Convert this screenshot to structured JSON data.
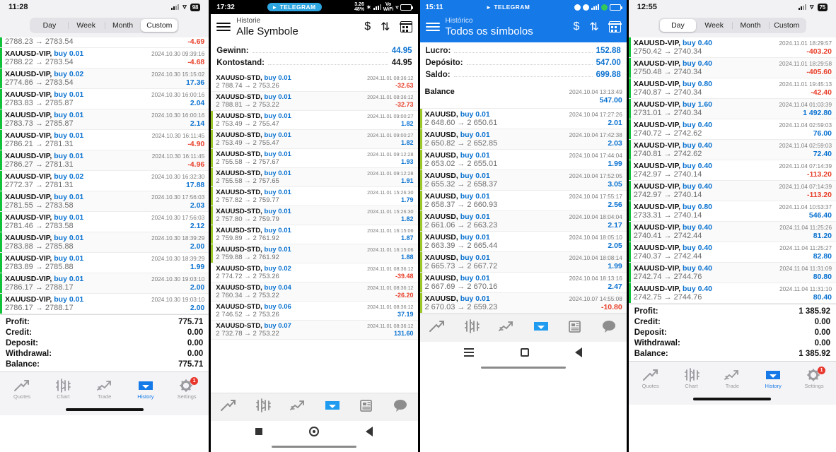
{
  "panel1": {
    "status": {
      "time": "11:28",
      "battery": "98",
      "wifi_icon": "wifi-icon",
      "signal_icon": "signal-icon"
    },
    "period_tabs": [
      {
        "label": "Day",
        "selected": false
      },
      {
        "label": "Week",
        "selected": false
      },
      {
        "label": "Month",
        "selected": false
      },
      {
        "label": "Custom",
        "selected": true
      }
    ],
    "partial_top_row": {
      "prices": "2788.23 → 2783.54",
      "pl": "-4.69"
    },
    "deals": [
      {
        "symbol": "XAUUSD-VIP,",
        "side": "buy 0.01",
        "time": "2024.10.30 09:39:16",
        "prices": "2788.22 → 2783.54",
        "pl": "-4.68",
        "neg": true
      },
      {
        "symbol": "XAUUSD-VIP,",
        "side": "buy 0.02",
        "time": "2024.10.30 15:15:02",
        "prices": "2774.86 → 2783.54",
        "pl": "17.36",
        "neg": false
      },
      {
        "symbol": "XAUUSD-VIP,",
        "side": "buy 0.01",
        "time": "2024.10.30 16:00:16",
        "prices": "2783.83 → 2785.87",
        "pl": "2.04",
        "neg": false
      },
      {
        "symbol": "XAUUSD-VIP,",
        "side": "buy 0.01",
        "time": "2024.10.30 16:00:16",
        "prices": "2783.73 → 2785.87",
        "pl": "2.14",
        "neg": false
      },
      {
        "symbol": "XAUUSD-VIP,",
        "side": "buy 0.01",
        "time": "2024.10.30 16:11:45",
        "prices": "2786.21 → 2781.31",
        "pl": "-4.90",
        "neg": true
      },
      {
        "symbol": "XAUUSD-VIP,",
        "side": "buy 0.01",
        "time": "2024.10.30 16:11:45",
        "prices": "2786.27 → 2781.31",
        "pl": "-4.96",
        "neg": true
      },
      {
        "symbol": "XAUUSD-VIP,",
        "side": "buy 0.02",
        "time": "2024.10.30 16:32:30",
        "prices": "2772.37 → 2781.31",
        "pl": "17.88",
        "neg": false
      },
      {
        "symbol": "XAUUSD-VIP,",
        "side": "buy 0.01",
        "time": "2024.10.30 17:56:03",
        "prices": "2781.55 → 2783.58",
        "pl": "2.03",
        "neg": false
      },
      {
        "symbol": "XAUUSD-VIP,",
        "side": "buy 0.01",
        "time": "2024.10.30 17:56:03",
        "prices": "2781.46 → 2783.58",
        "pl": "2.12",
        "neg": false
      },
      {
        "symbol": "XAUUSD-VIP,",
        "side": "buy 0.01",
        "time": "2024.10.30 18:39:29",
        "prices": "2783.88 → 2785.88",
        "pl": "2.00",
        "neg": false
      },
      {
        "symbol": "XAUUSD-VIP,",
        "side": "buy 0.01",
        "time": "2024.10.30 18:39:29",
        "prices": "2783.89 → 2785.88",
        "pl": "1.99",
        "neg": false
      },
      {
        "symbol": "XAUUSD-VIP,",
        "side": "buy 0.01",
        "time": "2024.10.30 19:03:10",
        "prices": "2786.17 → 2788.17",
        "pl": "2.00",
        "neg": false
      },
      {
        "symbol": "XAUUSD-VIP,",
        "side": "buy 0.01",
        "time": "2024.10.30 19:03:10",
        "prices": "2786.17 → 2788.17",
        "pl": "2.00",
        "neg": false
      }
    ],
    "totals": [
      {
        "label": "Profit:",
        "value": "775.71"
      },
      {
        "label": "Credit:",
        "value": "0.00"
      },
      {
        "label": "Deposit:",
        "value": "0.00"
      },
      {
        "label": "Withdrawal:",
        "value": "0.00"
      },
      {
        "label": "Balance:",
        "value": "775.71"
      }
    ],
    "tabs": [
      {
        "label": "Quotes",
        "icon": "quotes-icon",
        "selected": false,
        "badge": ""
      },
      {
        "label": "Chart",
        "icon": "chart-icon",
        "selected": false,
        "badge": ""
      },
      {
        "label": "Trade",
        "icon": "trade-icon",
        "selected": false,
        "badge": ""
      },
      {
        "label": "History",
        "icon": "history-icon",
        "selected": true,
        "badge": ""
      },
      {
        "label": "Settings",
        "icon": "settings-gear-icon",
        "selected": false,
        "badge": "1"
      }
    ]
  },
  "panel2": {
    "status": {
      "time": "17:32",
      "telegram": "TELEGRAM",
      "data_rate": "3.26",
      "data_unit": "48%",
      "volte": "Vo",
      "wifi_label": "WiFi"
    },
    "header": {
      "subtitle": "Historie",
      "title": "Alle Symbole",
      "icon_currency": "currency-filter-icon",
      "icon_sort": "sort-icon",
      "icon_calendar": "calendar-icon",
      "menu_icon": "hamburger-menu-icon"
    },
    "summary": [
      {
        "label": "Gewinn:",
        "value": "44.95",
        "accent": true
      },
      {
        "label": "Kontostand:",
        "value": "44.95",
        "accent": false
      }
    ],
    "deals": [
      {
        "symbol": "XAUUSD-STD,",
        "side": "buy 0.01",
        "time": "2024.11.01 08:36:12",
        "prices": "2 788.74 → 2 753.26",
        "pl": "-32.63",
        "neg": true,
        "bar": "none"
      },
      {
        "symbol": "XAUUSD-STD,",
        "side": "buy 0.01",
        "time": "2024.11.01 08:36:12",
        "prices": "2 788.81 → 2 753.22",
        "pl": "-32.73",
        "neg": true,
        "bar": "none"
      },
      {
        "symbol": "XAUUSD-STD,",
        "side": "buy 0.01",
        "time": "2024.11.01 09:00:27",
        "prices": "2 753.49 → 2 755.47",
        "pl": "1.82",
        "neg": false,
        "bar": "olive"
      },
      {
        "symbol": "XAUUSD-STD,",
        "side": "buy 0.01",
        "time": "2024.11.01 09:00:27",
        "prices": "2 753.49 → 2 755.47",
        "pl": "1.82",
        "neg": false,
        "bar": "olive"
      },
      {
        "symbol": "XAUUSD-STD,",
        "side": "buy 0.01",
        "time": "2024.11.01 09:12:28",
        "prices": "2 755.58 → 2 757.67",
        "pl": "1.93",
        "neg": false,
        "bar": "olive"
      },
      {
        "symbol": "XAUUSD-STD,",
        "side": "buy 0.01",
        "time": "2024.11.01 09:12:28",
        "prices": "2 755.58 → 2 757.65",
        "pl": "1.91",
        "neg": false,
        "bar": "olive"
      },
      {
        "symbol": "XAUUSD-STD,",
        "side": "buy 0.01",
        "time": "2024.11.01 15:26:30",
        "prices": "2 757.82 → 2 759.77",
        "pl": "1.79",
        "neg": false,
        "bar": "olive"
      },
      {
        "symbol": "XAUUSD-STD,",
        "side": "buy 0.01",
        "time": "2024.11.01 15:26:30",
        "prices": "2 757.80 → 2 759.79",
        "pl": "1.82",
        "neg": false,
        "bar": "olive"
      },
      {
        "symbol": "XAUUSD-STD,",
        "side": "buy 0.01",
        "time": "2024.11.01 16:15:06",
        "prices": "2 759.89 → 2 761.92",
        "pl": "1.87",
        "neg": false,
        "bar": "olive"
      },
      {
        "symbol": "XAUUSD-STD,",
        "side": "buy 0.01",
        "time": "2024.11.01 16:15:06",
        "prices": "2 759.88 → 2 761.92",
        "pl": "1.88",
        "neg": false,
        "bar": "olive"
      },
      {
        "symbol": "XAUUSD-STD,",
        "side": "buy 0.02",
        "time": "2024.11.01 08:36:12",
        "prices": "2 774.72 → 2 753.26",
        "pl": "-39.48",
        "neg": true,
        "bar": "none"
      },
      {
        "symbol": "XAUUSD-STD,",
        "side": "buy 0.04",
        "time": "2024.11.01 08:36:12",
        "prices": "2 760.34 → 2 753.22",
        "pl": "-26.20",
        "neg": true,
        "bar": "none"
      },
      {
        "symbol": "XAUUSD-STD,",
        "side": "buy 0.06",
        "time": "2024.11.01 08:36:12",
        "prices": "2 746.52 → 2 753.26",
        "pl": "37.19",
        "neg": false,
        "bar": "none"
      },
      {
        "symbol": "XAUUSD-STD,",
        "side": "buy 0.07",
        "time": "2024.11.01 08:36:12",
        "prices": "2 732.78 → 2 753.22",
        "pl": "131.60",
        "neg": false,
        "bar": "none"
      }
    ],
    "tabs": [
      {
        "icon": "quotes-icon",
        "selected": false
      },
      {
        "icon": "chart-icon",
        "selected": false
      },
      {
        "icon": "trade-icon",
        "selected": false
      },
      {
        "icon": "history-icon",
        "selected": true
      },
      {
        "icon": "news-icon",
        "selected": false
      },
      {
        "icon": "messages-icon",
        "selected": false
      }
    ],
    "navbar": [
      {
        "icon": "recents-square-icon"
      },
      {
        "icon": "home-circle-icon"
      },
      {
        "icon": "back-triangle-icon"
      }
    ]
  },
  "panel3": {
    "status": {
      "time": "15:11",
      "telegram": "TELEGRAM"
    },
    "header": {
      "subtitle": "Histórico",
      "title": "Todos os símbolos",
      "icon_currency": "currency-filter-icon",
      "icon_sort": "sort-icon",
      "icon_calendar": "calendar-icon",
      "menu_icon": "hamburger-menu-icon"
    },
    "summary": [
      {
        "label": "Lucro:",
        "value": "152.88"
      },
      {
        "label": "Depósito:",
        "value": "547.00"
      },
      {
        "label": "Saldo:",
        "value": "699.88"
      }
    ],
    "balance_row": {
      "label": "Balance",
      "time": "2024.10.04 13:13:49",
      "value": "547.00"
    },
    "deals": [
      {
        "symbol": "XAUUSD,",
        "side": "buy 0.01",
        "time": "2024.10.04 17:27:26",
        "prices": "2 648.60 → 2 650.61",
        "pl": "2.01",
        "neg": false
      },
      {
        "symbol": "XAUUSD,",
        "side": "buy 0.01",
        "time": "2024.10.04 17:42:38",
        "prices": "2 650.82 → 2 652.85",
        "pl": "2.03",
        "neg": false
      },
      {
        "symbol": "XAUUSD,",
        "side": "buy 0.01",
        "time": "2024.10.04 17:44:04",
        "prices": "2 653.02 → 2 655.01",
        "pl": "1.99",
        "neg": false
      },
      {
        "symbol": "XAUUSD,",
        "side": "buy 0.01",
        "time": "2024.10.04 17:52:05",
        "prices": "2 655.32 → 2 658.37",
        "pl": "3.05",
        "neg": false
      },
      {
        "symbol": "XAUUSD,",
        "side": "buy 0.01",
        "time": "2024.10.04 17:55:17",
        "prices": "2 658.37 → 2 660.93",
        "pl": "2.56",
        "neg": false
      },
      {
        "symbol": "XAUUSD,",
        "side": "buy 0.01",
        "time": "2024.10.04 18:04:04",
        "prices": "2 661.06 → 2 663.23",
        "pl": "2.17",
        "neg": false
      },
      {
        "symbol": "XAUUSD,",
        "side": "buy 0.01",
        "time": "2024.10.04 18:05:10",
        "prices": "2 663.39 → 2 665.44",
        "pl": "2.05",
        "neg": false
      },
      {
        "symbol": "XAUUSD,",
        "side": "buy 0.01",
        "time": "2024.10.04 18:08:14",
        "prices": "2 665.73 → 2 667.72",
        "pl": "1.99",
        "neg": false
      },
      {
        "symbol": "XAUUSD,",
        "side": "buy 0.01",
        "time": "2024.10.04 18:13:16",
        "prices": "2 667.69 → 2 670.16",
        "pl": "2.47",
        "neg": false
      },
      {
        "symbol": "XAUUSD,",
        "side": "buy 0.01",
        "time": "2024.10.07 14:55:08",
        "prices": "2 670.03 → 2 659.23",
        "pl": "-10.80",
        "neg": true
      }
    ],
    "tabs": [
      {
        "icon": "quotes-icon",
        "selected": false
      },
      {
        "icon": "chart-icon",
        "selected": false
      },
      {
        "icon": "trade-icon",
        "selected": false
      },
      {
        "icon": "history-icon",
        "selected": true
      },
      {
        "icon": "news-icon",
        "selected": false
      },
      {
        "icon": "messages-icon",
        "selected": false
      }
    ],
    "navbar": [
      {
        "icon": "recents-lines-icon"
      },
      {
        "icon": "home-square-icon"
      },
      {
        "icon": "back-triangle-icon"
      }
    ]
  },
  "panel4": {
    "status": {
      "time": "12:55",
      "battery": "75",
      "wifi_icon": "wifi-icon",
      "signal_icon": "signal-icon"
    },
    "period_tabs": [
      {
        "label": "Day",
        "selected": true
      },
      {
        "label": "Week",
        "selected": false
      },
      {
        "label": "Month",
        "selected": false
      },
      {
        "label": "Custom",
        "selected": false
      }
    ],
    "deals": [
      {
        "symbol": "XAUUSD-VIP,",
        "side": "buy 0.40",
        "time": "2024.11.01 18:29:57",
        "prices": "2750.42 → 2740.34",
        "pl": "-403.20",
        "neg": true
      },
      {
        "symbol": "XAUUSD-VIP,",
        "side": "buy 0.40",
        "time": "2024.11.01 18:29:58",
        "prices": "2750.48 → 2740.34",
        "pl": "-405.60",
        "neg": true
      },
      {
        "symbol": "XAUUSD-VIP,",
        "side": "buy 0.80",
        "time": "2024.11.01 19:45:13",
        "prices": "2740.87 → 2740.34",
        "pl": "-42.40",
        "neg": true
      },
      {
        "symbol": "XAUUSD-VIP,",
        "side": "buy 1.60",
        "time": "2024.11.04 01:03:39",
        "prices": "2731.01 → 2740.34",
        "pl": "1 492.80",
        "neg": false
      },
      {
        "symbol": "XAUUSD-VIP,",
        "side": "buy 0.40",
        "time": "2024.11.04 02:59:03",
        "prices": "2740.72 → 2742.62",
        "pl": "76.00",
        "neg": false
      },
      {
        "symbol": "XAUUSD-VIP,",
        "side": "buy 0.40",
        "time": "2024.11.04 02:59:03",
        "prices": "2740.81 → 2742.62",
        "pl": "72.40",
        "neg": false
      },
      {
        "symbol": "XAUUSD-VIP,",
        "side": "buy 0.40",
        "time": "2024.11.04 07:14:39",
        "prices": "2742.97 → 2740.14",
        "pl": "-113.20",
        "neg": true
      },
      {
        "symbol": "XAUUSD-VIP,",
        "side": "buy 0.40",
        "time": "2024.11.04 07:14:39",
        "prices": "2742.97 → 2740.14",
        "pl": "-113.20",
        "neg": true
      },
      {
        "symbol": "XAUUSD-VIP,",
        "side": "buy 0.80",
        "time": "2024.11.04 10:53:37",
        "prices": "2733.31 → 2740.14",
        "pl": "546.40",
        "neg": false
      },
      {
        "symbol": "XAUUSD-VIP,",
        "side": "buy 0.40",
        "time": "2024.11.04 11:25:26",
        "prices": "2740.41 → 2742.44",
        "pl": "81.20",
        "neg": false
      },
      {
        "symbol": "XAUUSD-VIP,",
        "side": "buy 0.40",
        "time": "2024.11.04 11:25:27",
        "prices": "2740.37 → 2742.44",
        "pl": "82.80",
        "neg": false
      },
      {
        "symbol": "XAUUSD-VIP,",
        "side": "buy 0.40",
        "time": "2024.11.04 11:31:09",
        "prices": "2742.74 → 2744.76",
        "pl": "80.80",
        "neg": false
      },
      {
        "symbol": "XAUUSD-VIP,",
        "side": "buy 0.40",
        "time": "2024.11.04 11:31:10",
        "prices": "2742.75 → 2744.76",
        "pl": "80.40",
        "neg": false
      }
    ],
    "totals": [
      {
        "label": "Profit:",
        "value": "1 385.92"
      },
      {
        "label": "Credit:",
        "value": "0.00"
      },
      {
        "label": "Deposit:",
        "value": "0.00"
      },
      {
        "label": "Withdrawal:",
        "value": "0.00"
      },
      {
        "label": "Balance:",
        "value": "1 385.92"
      }
    ],
    "tabs": [
      {
        "label": "Quotes",
        "icon": "quotes-icon",
        "selected": false,
        "badge": ""
      },
      {
        "label": "Chart",
        "icon": "chart-icon",
        "selected": false,
        "badge": ""
      },
      {
        "label": "Trade",
        "icon": "trade-icon",
        "selected": false,
        "badge": ""
      },
      {
        "label": "History",
        "icon": "history-icon",
        "selected": true,
        "badge": ""
      },
      {
        "label": "Settings",
        "icon": "settings-gear-icon",
        "selected": false,
        "badge": "1"
      }
    ]
  },
  "colors": {
    "accent": "#0a72d0",
    "positive": "#0a72d0",
    "negative": "#e8412c",
    "bar_green": "#11c23a",
    "bar_olive": "#9cc72b",
    "header_blue": "#1579e8"
  }
}
